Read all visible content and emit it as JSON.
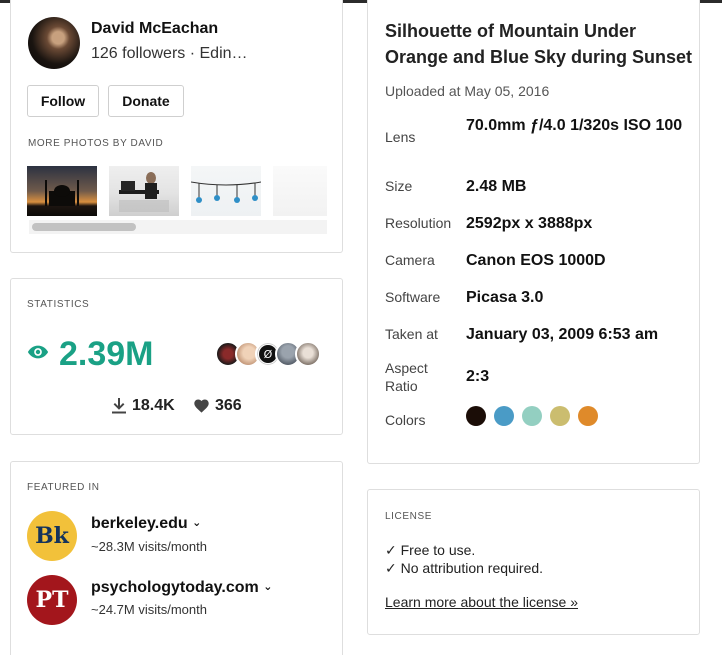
{
  "author": {
    "name": "David McEachan",
    "subtitle": "126 followers · Edin…",
    "follow_label": "Follow",
    "donate_label": "Donate",
    "more_photos_label": "MORE PHOTOS BY DAVID"
  },
  "statistics": {
    "label": "STATISTICS",
    "views": "2.39M",
    "downloads": "18.4K",
    "likes": "366",
    "accent_color": "#1aa185"
  },
  "featured": {
    "label": "FEATURED IN",
    "items": [
      {
        "name": "berkeley.edu",
        "visits": "~28.3M visits/month",
        "logo_text": "Bk",
        "logo_bg": "#f2c13a",
        "logo_fg": "#14335c"
      },
      {
        "name": "psychologytoday.com",
        "visits": "~24.7M visits/month",
        "logo_text": "PT",
        "logo_bg": "#a3161c",
        "logo_fg": "#ffffff"
      }
    ]
  },
  "details": {
    "title": "Silhouette of Mountain Under Orange and Blue Sky during Sunset",
    "uploaded": "Uploaded at May 05, 2016",
    "rows": [
      {
        "label": "Lens",
        "value": "70.0mm ƒ/4.0 1/320s ISO 100"
      },
      {
        "label": "Size",
        "value": "2.48 MB"
      },
      {
        "label": "Resolution",
        "value": "2592px x 3888px"
      },
      {
        "label": "Camera",
        "value": "Canon EOS 1000D"
      },
      {
        "label": "Software",
        "value": "Picasa 3.0"
      },
      {
        "label": "Taken at",
        "value": "January 03, 2009 6:53 am"
      },
      {
        "label": "Aspect Ratio",
        "value": "2:3"
      },
      {
        "label": "Colors",
        "value": ""
      }
    ],
    "colors": [
      "#1b0d07",
      "#4a9bc6",
      "#93cfc1",
      "#cbbd6f",
      "#df8a2a"
    ]
  },
  "license": {
    "label": "LICENSE",
    "line1": "✓ Free to use.",
    "line2": "✓ No attribution required.",
    "link": "Learn more about the license »"
  }
}
